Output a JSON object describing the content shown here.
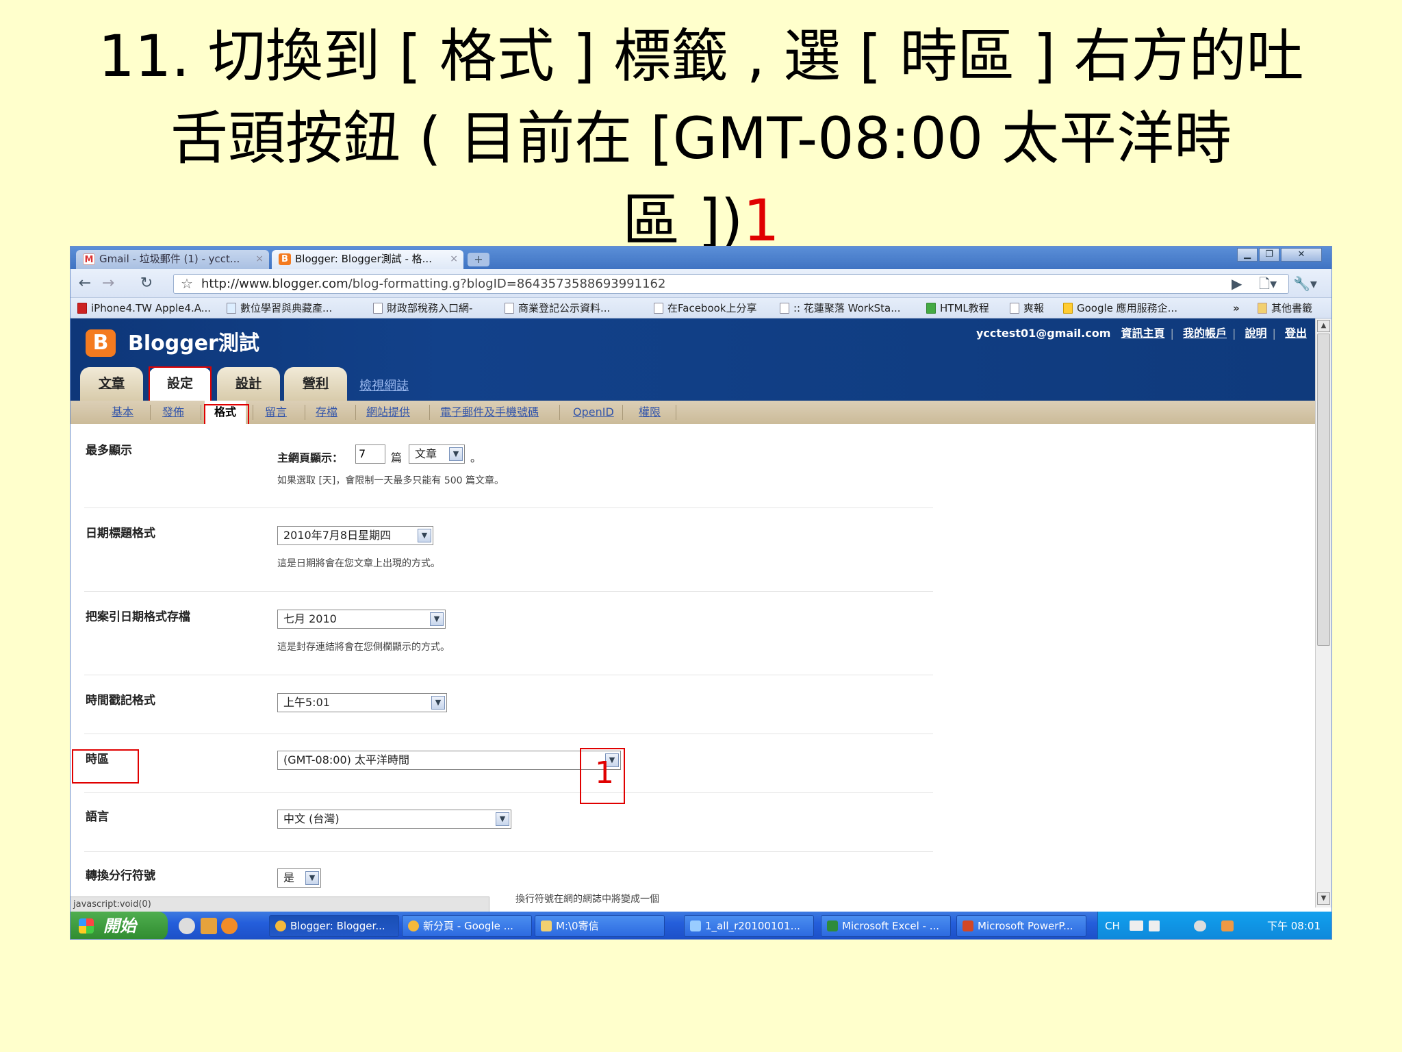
{
  "slide": {
    "title_line1": "11. 切換到 [ 格式 ] 標籤 , 選 [ 時區 ] 右方的吐",
    "title_line2": "舌頭按鈕 ( 目前在 [GMT-08:00 太平洋時",
    "title_line3": "區 ])",
    "title_mark": "1"
  },
  "browser": {
    "tabs": [
      {
        "label": "Gmail - 垃圾郵件 (1) - ycct...",
        "icon": "gmail-icon"
      },
      {
        "label": "Blogger: Blogger測試 - 格...",
        "icon": "blogger-icon"
      }
    ],
    "tab_close": "×",
    "new_tab": "+",
    "url_host": "http://www.blogger.com",
    "url_path": "/blog-formatting.g?blogID=8643573588693991162",
    "bookmarks": [
      "iPhone4.TW Apple4.A...",
      "數位學習與典藏產...",
      "財政部稅務入口網-",
      "商業登記公示資料...",
      "在Facebook上分享",
      ":: 花蓮聚落 WorkSta...",
      "HTML教程",
      "爽報",
      "Google 應用服務企..."
    ],
    "bookmarks_more": "»",
    "other_bookmarks": "其他書籤",
    "status_text": "javascript:void(0)"
  },
  "blogger": {
    "logo_letter": "B",
    "blog_title": "Blogger測試",
    "email": "ycctest01@gmail.com",
    "links": [
      "資訊主頁",
      "我的帳戶",
      "說明",
      "登出"
    ],
    "main_tabs": [
      "文章",
      "設定",
      "設計",
      "營利"
    ],
    "view_blog": "檢視網誌",
    "sub_tabs": [
      "基本",
      "發佈",
      "格式",
      "留言",
      "存檔",
      "網站提供",
      "電子郵件及手機號碼",
      "OpenID",
      "權限"
    ]
  },
  "settings": {
    "max_show": {
      "label": "最多顯示",
      "prefix": "主網頁顯示：",
      "value": "7",
      "unit": "篇",
      "type": "文章",
      "suffix": "。",
      "desc": "如果選取 [天]，會限制一天最多只能有 500 篇文章。"
    },
    "date_header": {
      "label": "日期標題格式",
      "value": "2010年7月8日星期四",
      "desc": "這是日期將會在您文章上出現的方式。"
    },
    "archive_date": {
      "label": "把案引日期格式存檔",
      "value": "七月 2010",
      "desc": "這是封存連結將會在您側欄顯示的方式。"
    },
    "timestamp": {
      "label": "時間戳記格式",
      "value": "上午5:01"
    },
    "timezone": {
      "label": "時區",
      "value": "(GMT-08:00) 太平洋時間"
    },
    "language": {
      "label": "語言",
      "value": "中文 (台灣)"
    },
    "line_breaks": {
      "label": "轉換分行符號",
      "value": "是",
      "desc_partial": "換行符號在網的網誌中將變成一個"
    },
    "annotation": "1"
  },
  "taskbar": {
    "start": "開始",
    "items": [
      "Blogger: Blogger...",
      "新分頁 - Google ...",
      "M:\\0寄信",
      "1_all_r20100101...",
      "Microsoft Excel - ...",
      "Microsoft PowerP..."
    ],
    "lang": "CH",
    "clock": "下午 08:01"
  },
  "colors": {
    "slide_bg": "#ffffcc",
    "highlight": "#e00000",
    "blogger_header": "#12418a",
    "blogger_orange": "#f47b20"
  }
}
